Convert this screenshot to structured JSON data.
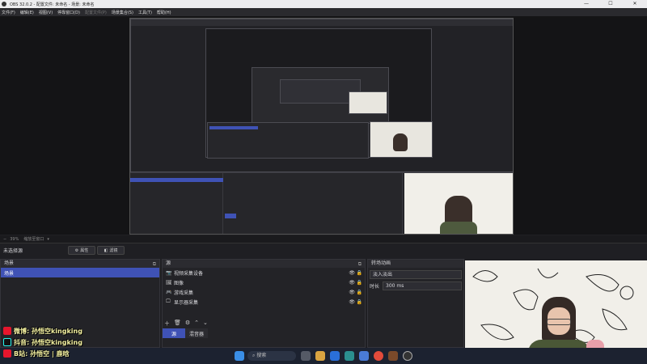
{
  "window": {
    "title": "OBS 32.0.2 - 配置文件: 未命名 - 场景: 未命名",
    "minimize": "—",
    "maximize": "☐",
    "close": "✕"
  },
  "menu": {
    "items": [
      "文件(F)",
      "编辑(E)",
      "视图(V)",
      "停靠窗口(D)",
      "配置文件(P)",
      "场景集合(S)",
      "工具(T)",
      "帮助(H)"
    ]
  },
  "status": {
    "zoom": "39%",
    "zoom_mode": "缩放至窗口"
  },
  "controls": {
    "scene_label": "未选择源",
    "properties": "属性",
    "filters": "滤镜"
  },
  "scenes": {
    "title": "场景",
    "items": [
      "场景"
    ]
  },
  "sources": {
    "title": "源",
    "items": [
      {
        "icon": "camera-icon",
        "glyph": "📷",
        "label": "视频采集设备"
      },
      {
        "icon": "image-icon",
        "glyph": "🖼",
        "label": "图像"
      },
      {
        "icon": "gamepad-icon",
        "glyph": "🎮",
        "label": "游戏采集"
      },
      {
        "icon": "monitor-icon",
        "glyph": "🖵",
        "label": "显示器采集"
      }
    ],
    "tab_source": "源",
    "tab_mixer": "混音器"
  },
  "transitions": {
    "title": "转场动画",
    "type": "淡入淡出",
    "duration_label": "时长",
    "duration_value": "300 ms"
  },
  "overlay": {
    "line1": "微博: 孙悟空kingking",
    "line2": "抖音: 孙悟空kingking",
    "line3": "B站: 孙悟空 | 鹿晗"
  },
  "taskbar": {
    "search": "搜索"
  },
  "colors": {
    "accent": "#3f52b5",
    "panel": "#232327",
    "background": "#1f1f23"
  }
}
